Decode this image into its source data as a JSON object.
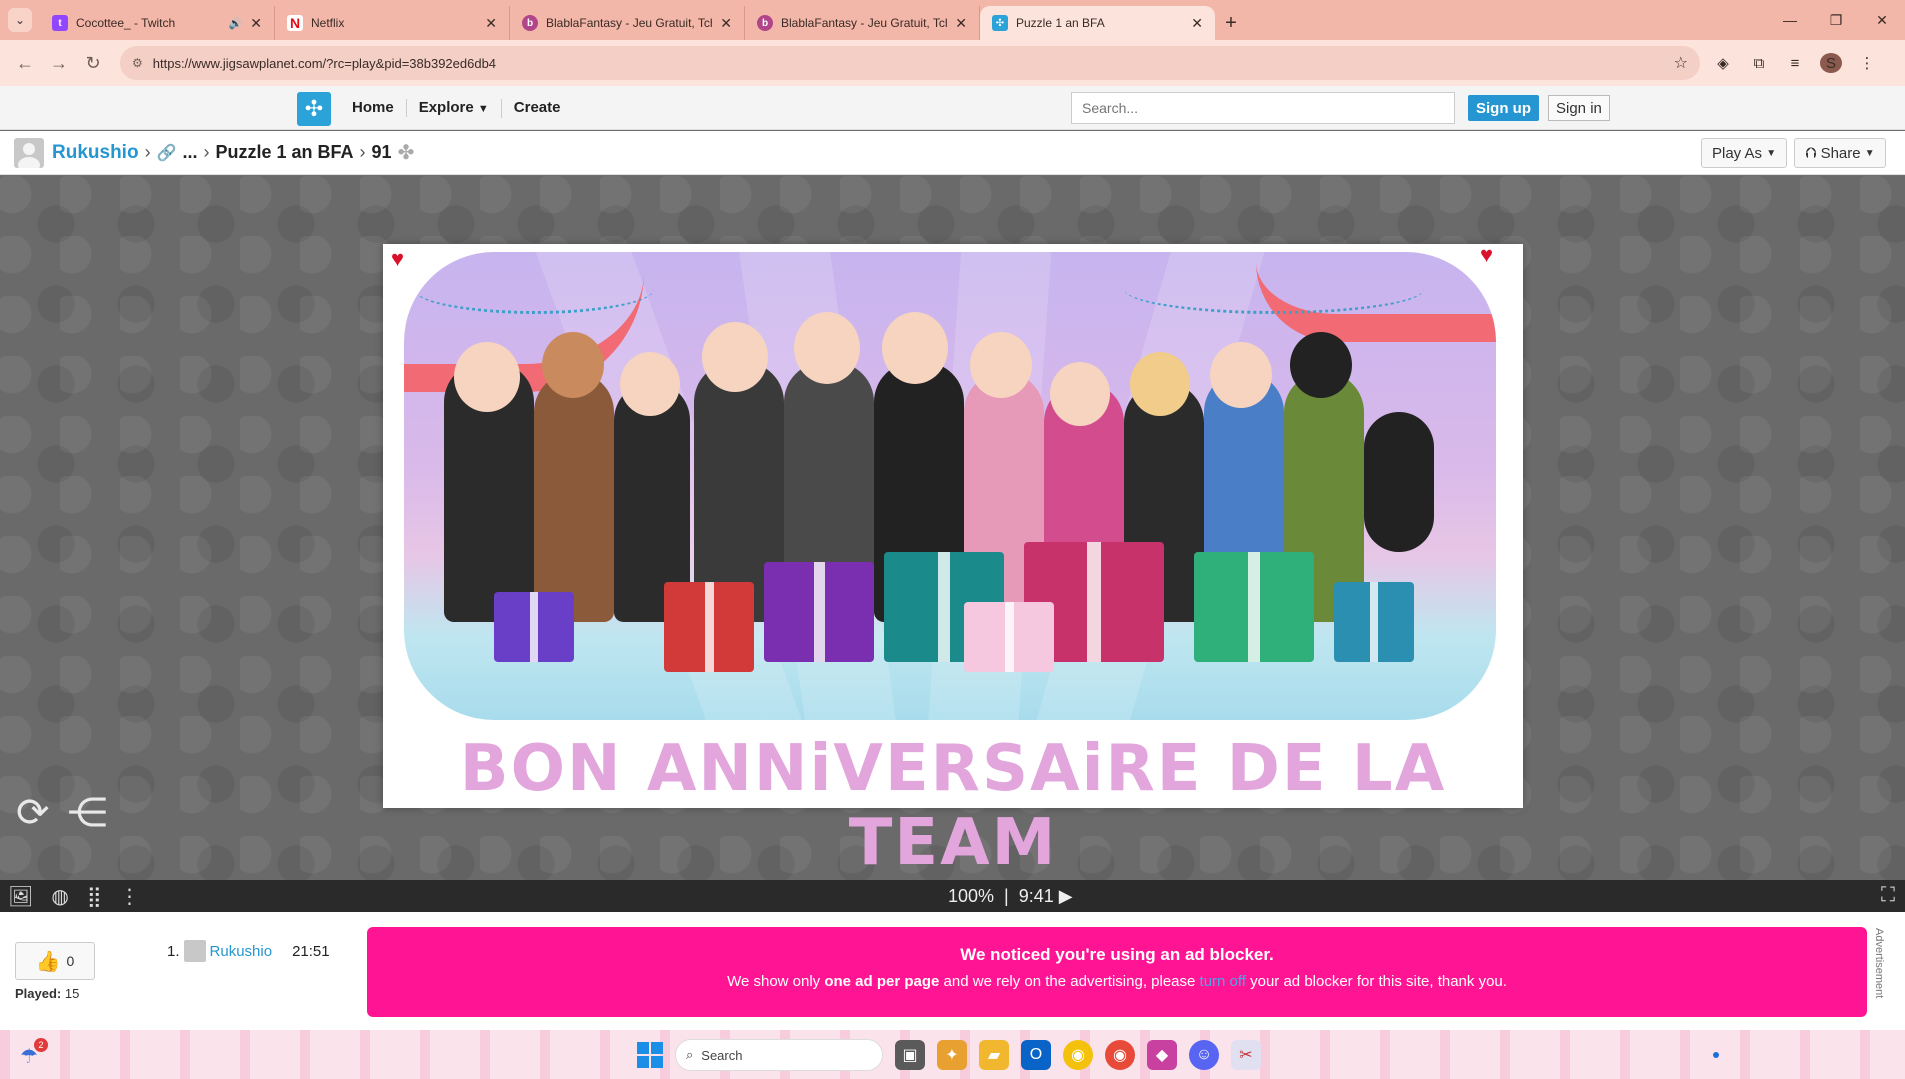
{
  "browser": {
    "tabs": [
      {
        "title": "Cocottee_ - Twitch",
        "favicon": "twitch-icon",
        "color": "#9146ff",
        "audio": true
      },
      {
        "title": "Netflix",
        "favicon": "netflix-icon",
        "color": "#e50914"
      },
      {
        "title": "BlablaFantasy - Jeu Gratuit, Tch...",
        "favicon": "blablafantasy-icon",
        "color": "#b0458a"
      },
      {
        "title": "BlablaFantasy - Jeu Gratuit, Tch...",
        "favicon": "blablafantasy-icon",
        "color": "#b0458a"
      },
      {
        "title": "Puzzle 1 an BFA",
        "favicon": "jigsawplanet-icon",
        "color": "#2ba2d8",
        "active": true
      }
    ],
    "url": "https://www.jigsawplanet.com/?rc=play&pid=38b392ed6db4",
    "profile_initial": "S"
  },
  "site": {
    "nav": {
      "home": "Home",
      "explore": "Explore",
      "create": "Create"
    },
    "search_placeholder": "Search...",
    "signup": "Sign up",
    "signin": "Sign in"
  },
  "breadcrumb": {
    "user": "Rukushio",
    "ellipsis": "...",
    "puzzle_title": "Puzzle 1 an BFA",
    "pieces": "91",
    "play_as": "Play As",
    "share": "Share"
  },
  "puzzle": {
    "caption": "BON ANNiVERSAiRE DE LA TEAM",
    "zoom": "100%",
    "timer": "9:41"
  },
  "stats": {
    "likes": "0",
    "played_label": "Played:",
    "played": "15",
    "leaderboard": [
      {
        "rank": "1.",
        "user": "Rukushio",
        "time": "21:51"
      }
    ]
  },
  "adblock": {
    "heading": "We noticed you're using an ad blocker.",
    "line_pre": "We show only ",
    "line_bold": "one ad per page",
    "line_mid": " and we rely on the advertising, please ",
    "line_link": "turn off",
    "line_post": " your ad blocker for this site, thank you.",
    "side_label": "Advertisement"
  },
  "taskbar": {
    "search": "Search",
    "weather_badge": "2"
  }
}
